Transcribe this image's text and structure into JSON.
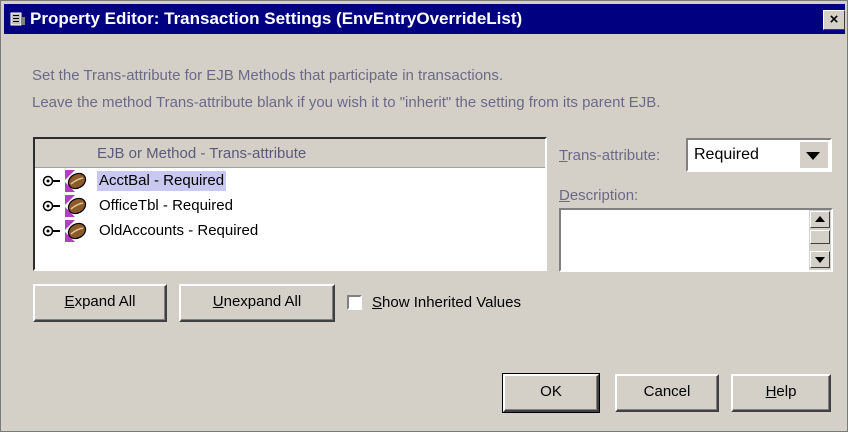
{
  "window": {
    "title": "Property Editor: Transaction Settings (EnvEntryOverrideList)",
    "close_label": "×"
  },
  "instructions": {
    "line1": "Set the Trans-attribute for EJB Methods that participate in transactions.",
    "line2": "Leave the method Trans-attribute blank if you wish it to \"inherit\" the setting from its parent EJB."
  },
  "tree": {
    "header": "EJB or Method   -   Trans-attribute",
    "items": [
      {
        "label": "AcctBal  -  Required",
        "selected": true
      },
      {
        "label": "OfficeTbl  -  Required",
        "selected": false
      },
      {
        "label": "OldAccounts  -  Required",
        "selected": false
      }
    ]
  },
  "trans_attribute": {
    "label_u": "T",
    "label_rest": "rans-attribute:",
    "value": "Required"
  },
  "description": {
    "label_u": "D",
    "label_rest": "escription:",
    "value": ""
  },
  "buttons": {
    "expand_all_u": "E",
    "expand_all_rest": "xpand All",
    "unexpand_all_u": "U",
    "unexpand_all_rest": "nexpand All",
    "show_inherited_u": "S",
    "show_inherited_rest": "how Inherited Values",
    "show_inherited_checked": false,
    "ok": "OK",
    "cancel": "Cancel",
    "help_u": "H",
    "help_rest": "elp"
  },
  "colors": {
    "titlebar": "#000080",
    "dialog_bg": "#d4d0c8",
    "selection": "#c8c8f0",
    "instruction_text": "#6b6a86"
  },
  "icons": {
    "window": "window-icon",
    "tree_toggle": "expand-toggle-icon",
    "bean": "ejb-bean-icon"
  }
}
